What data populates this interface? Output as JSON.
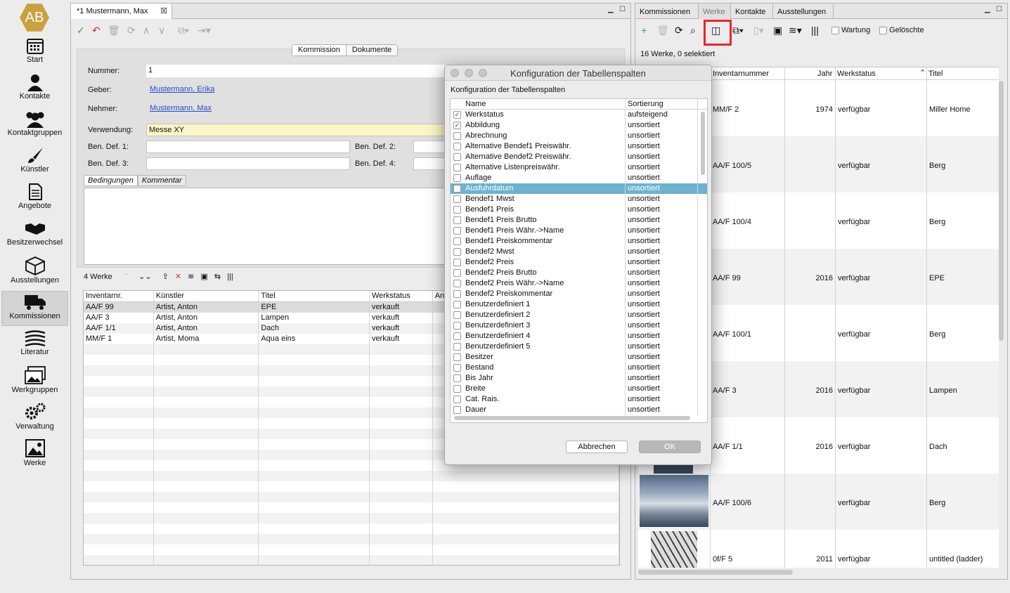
{
  "sidebar": {
    "logo": "AB",
    "items": [
      {
        "label": "Start",
        "icon": "calendar-icon"
      },
      {
        "label": "Kontakte",
        "icon": "person-icon"
      },
      {
        "label": "Kontaktgruppen",
        "icon": "group-icon"
      },
      {
        "label": "Künstler",
        "icon": "brush-icon"
      },
      {
        "label": "Angebote",
        "icon": "document-icon"
      },
      {
        "label": "Besitzerwechsel",
        "icon": "handshake-icon"
      },
      {
        "label": "Ausstellungen",
        "icon": "box-icon"
      },
      {
        "label": "Kommissionen",
        "icon": "truck-icon"
      },
      {
        "label": "Literatur",
        "icon": "books-icon"
      },
      {
        "label": "Werkgruppen",
        "icon": "images-icon"
      },
      {
        "label": "Verwaltung",
        "icon": "gears-icon"
      },
      {
        "label": "Werke",
        "icon": "picture-icon"
      }
    ],
    "active": "Kommissionen"
  },
  "editor": {
    "tab_title": "*1 Mustermann, Max",
    "segments": [
      "Kommission",
      "Dokumente"
    ],
    "fields": {
      "nummer_label": "Nummer:",
      "nummer_value": "1",
      "geber_label": "Geber:",
      "geber_value": "Mustermann, Erika",
      "nehmer_label": "Nehmer:",
      "nehmer_value": "Mustermann, Max",
      "verwendung_label": "Verwendung:",
      "verwendung_value": "Messe XY",
      "bendef1_label": "Ben. Def. 1:",
      "bendef2_label": "Ben. Def. 2:",
      "bendef3_label": "Ben. Def. 3:",
      "bendef4_label": "Ben. Def. 4:"
    },
    "subtabs": [
      "Bedingungen",
      "Kommentar"
    ],
    "works_count": "4 Werke",
    "table": {
      "columns": [
        "Inventarnr.",
        "Künstler",
        "Titel",
        "Werkstatus",
        "An"
      ],
      "rows": [
        [
          "AA/F 99",
          "Artist, Anton",
          "EPE",
          "verkauft"
        ],
        [
          "AA/F 3",
          "Artist, Anton",
          "Lampen",
          "verkauft"
        ],
        [
          "AA/F 1/1",
          "Artist, Anton",
          "Dach",
          "verkauft"
        ],
        [
          "MM/F 1",
          "Artist, Moma",
          "Aqua eins",
          "verkauft"
        ]
      ]
    }
  },
  "works_panel": {
    "tabs": [
      "Kommissionen",
      "Werke",
      "Kontakte",
      "Ausstellungen"
    ],
    "active_tab": "Werke",
    "checkboxes": [
      "Wartung",
      "Gelöschte"
    ],
    "count_text": "16 Werke, 0 selektiert",
    "columns": [
      "Inventarnummer",
      "Jahr",
      "Werkstatus",
      "Titel"
    ],
    "rows": [
      {
        "inv": "MM/F 2",
        "jahr": "1974",
        "status": "verfügbar",
        "titel": "Miller Home"
      },
      {
        "inv": "AA/F 100/5",
        "jahr": "",
        "status": "verfügbar",
        "titel": "Berg"
      },
      {
        "inv": "AA/F 100/4",
        "jahr": "",
        "status": "verfügbar",
        "titel": "Berg"
      },
      {
        "inv": "AA/F 99",
        "jahr": "2016",
        "status": "verfügbar",
        "titel": "EPE"
      },
      {
        "inv": "AA/F 100/1",
        "jahr": "",
        "status": "verfügbar",
        "titel": "Berg"
      },
      {
        "inv": "AA/F 3",
        "jahr": "2016",
        "status": "verfügbar",
        "titel": "Lampen"
      },
      {
        "inv": "AA/F 1/1",
        "jahr": "2016",
        "status": "verfügbar",
        "titel": "Dach"
      },
      {
        "inv": "AA/F 100/6",
        "jahr": "",
        "status": "verfügbar",
        "titel": "Berg"
      },
      {
        "inv": "0f/F 5",
        "jahr": "2011",
        "status": "verfügbar",
        "titel": "untitled (ladder)"
      }
    ],
    "highlight_color": "#e8262a"
  },
  "dialog": {
    "window_title": "Konfiguration der Tabellenspalten",
    "heading": "Konfiguration der Tabellenspalten",
    "col_name": "Name",
    "col_sort": "Sortierung",
    "rows": [
      {
        "name": "Werkstatus",
        "sort": "aufsteigend",
        "checked": true
      },
      {
        "name": "Abbildung",
        "sort": "unsortiert",
        "checked": true
      },
      {
        "name": "Abrechnung",
        "sort": "unsortiert",
        "checked": false
      },
      {
        "name": "Alternative Bendef1 Preiswähr.",
        "sort": "unsortiert",
        "checked": false
      },
      {
        "name": "Alternative Bendef2 Preiswähr.",
        "sort": "unsortiert",
        "checked": false
      },
      {
        "name": "Alternative Listenpreiswähr.",
        "sort": "unsortiert",
        "checked": false
      },
      {
        "name": "Auflage",
        "sort": "unsortiert",
        "checked": false
      },
      {
        "name": "Ausfuhrdatum",
        "sort": "unsortiert",
        "checked": false,
        "selected": true
      },
      {
        "name": "Bendef1 Mwst",
        "sort": "unsortiert",
        "checked": false
      },
      {
        "name": "Bendef1 Preis",
        "sort": "unsortiert",
        "checked": false
      },
      {
        "name": "Bendef1 Preis Brutto",
        "sort": "unsortiert",
        "checked": false
      },
      {
        "name": "Bendef1 Preis Währ.->Name",
        "sort": "unsortiert",
        "checked": false
      },
      {
        "name": "Bendef1 Preiskommentar",
        "sort": "unsortiert",
        "checked": false
      },
      {
        "name": "Bendef2 Mwst",
        "sort": "unsortiert",
        "checked": false
      },
      {
        "name": "Bendef2 Preis",
        "sort": "unsortiert",
        "checked": false
      },
      {
        "name": "Bendef2 Preis Brutto",
        "sort": "unsortiert",
        "checked": false
      },
      {
        "name": "Bendef2 Preis Währ.->Name",
        "sort": "unsortiert",
        "checked": false
      },
      {
        "name": "Bendef2 Preiskommentar",
        "sort": "unsortiert",
        "checked": false
      },
      {
        "name": "Benutzerdefiniert 1",
        "sort": "unsortiert",
        "checked": false
      },
      {
        "name": "Benutzerdefiniert 2",
        "sort": "unsortiert",
        "checked": false
      },
      {
        "name": "Benutzerdefiniert 3",
        "sort": "unsortiert",
        "checked": false
      },
      {
        "name": "Benutzerdefiniert 4",
        "sort": "unsortiert",
        "checked": false
      },
      {
        "name": "Benutzerdefiniert 5",
        "sort": "unsortiert",
        "checked": false
      },
      {
        "name": "Besitzer",
        "sort": "unsortiert",
        "checked": false
      },
      {
        "name": "Bestand",
        "sort": "unsortiert",
        "checked": false
      },
      {
        "name": "Bis Jahr",
        "sort": "unsortiert",
        "checked": false
      },
      {
        "name": "Breite",
        "sort": "unsortiert",
        "checked": false
      },
      {
        "name": "Cat. Rais.",
        "sort": "unsortiert",
        "checked": false
      },
      {
        "name": "Dauer",
        "sort": "unsortiert",
        "checked": false
      }
    ],
    "cancel_label": "Abbrechen",
    "ok_label": "OK"
  }
}
